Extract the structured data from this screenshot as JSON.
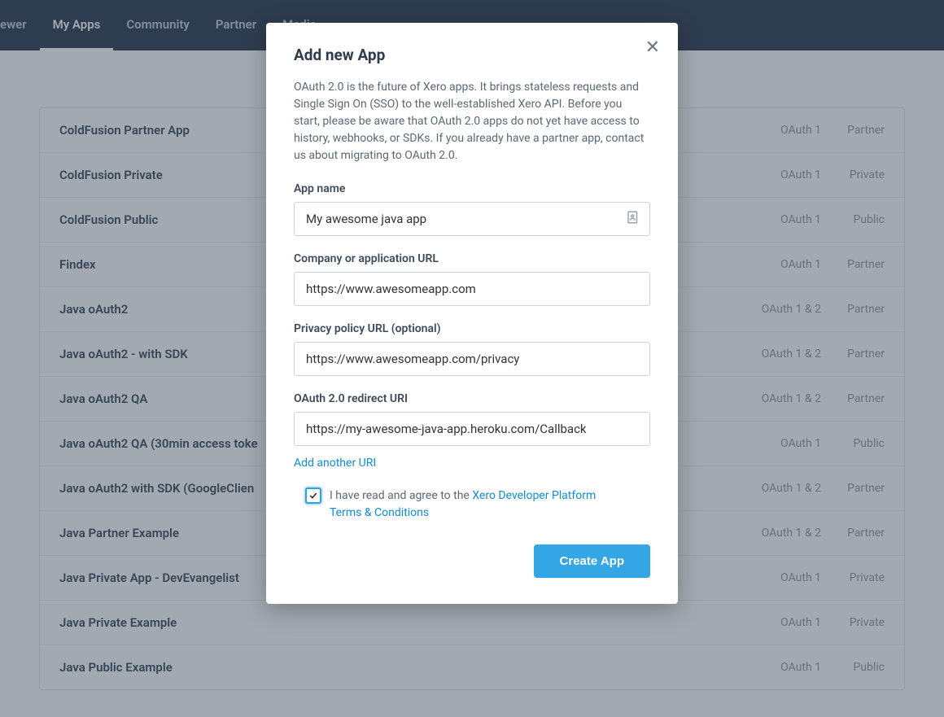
{
  "nav": {
    "items": [
      {
        "label": "ewer"
      },
      {
        "label": "My Apps"
      },
      {
        "label": "Community"
      },
      {
        "label": "Partner"
      },
      {
        "label": "Media"
      }
    ]
  },
  "apps": [
    {
      "name": "ColdFusion Partner App",
      "oauth": "OAuth 1",
      "type": "Partner"
    },
    {
      "name": "ColdFusion Private",
      "oauth": "OAuth 1",
      "type": "Private"
    },
    {
      "name": "ColdFusion Public",
      "oauth": "OAuth 1",
      "type": "Public"
    },
    {
      "name": "Findex",
      "oauth": "OAuth 1",
      "type": "Partner"
    },
    {
      "name": "Java oAuth2",
      "oauth": "OAuth 1 & 2",
      "type": "Partner"
    },
    {
      "name": "Java oAuth2 - with SDK",
      "oauth": "OAuth 1 & 2",
      "type": "Partner"
    },
    {
      "name": "Java oAuth2 QA",
      "oauth": "OAuth 1 & 2",
      "type": "Partner"
    },
    {
      "name": "Java oAuth2 QA (30min access toke",
      "oauth": "OAuth 1",
      "type": "Public"
    },
    {
      "name": "Java oAuth2 with SDK (GoogleClien",
      "oauth": "OAuth 1 & 2",
      "type": "Partner"
    },
    {
      "name": "Java Partner Example",
      "oauth": "OAuth 1 & 2",
      "type": "Partner"
    },
    {
      "name": "Java Private App - DevEvangelist",
      "oauth": "OAuth 1",
      "type": "Private"
    },
    {
      "name": "Java Private Example",
      "oauth": "OAuth 1",
      "type": "Private"
    },
    {
      "name": "Java Public Example",
      "oauth": "OAuth 1",
      "type": "Public"
    }
  ],
  "modal": {
    "title": "Add new App",
    "description": "OAuth 2.0 is the future of Xero apps. It brings stateless requests and Single Sign On (SSO) to the well-established Xero API. Before you start, please be aware that OAuth 2.0 apps do not yet have access to history, webhooks, or SDKs. If you already have a partner app, contact us about migrating to OAuth 2.0.",
    "fields": {
      "app_name_label": "App name",
      "app_name_value": "My awesome java app",
      "company_url_label": "Company or application URL",
      "company_url_value": "https://www.awesomeapp.com",
      "privacy_url_label": "Privacy policy URL (optional)",
      "privacy_url_value": "https://www.awesomeapp.com/privacy",
      "redirect_label": "OAuth 2.0 redirect URI",
      "redirect_value": "https://my-awesome-java-app.heroku.com/Callback"
    },
    "add_uri_link": "Add another URI",
    "terms_text_prefix": "I have read and agree to the ",
    "terms_link_text": "Xero Developer Platform Terms & Conditions",
    "terms_checked": true,
    "create_button": "Create App"
  }
}
